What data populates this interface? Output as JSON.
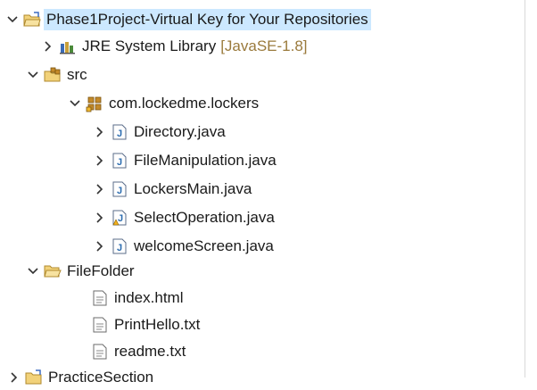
{
  "tree": {
    "project": {
      "label": "Phase1Project-Virtual Key for Your Repositories"
    },
    "jre": {
      "label": "JRE System Library",
      "decoration": "[JavaSE-1.8]"
    },
    "src": {
      "label": "src"
    },
    "package": {
      "label": "com.lockedme.lockers"
    },
    "files": [
      {
        "label": "Directory.java",
        "icon": "java-file-icon"
      },
      {
        "label": "FileManipulation.java",
        "icon": "java-file-icon"
      },
      {
        "label": "LockersMain.java",
        "icon": "java-file-icon"
      },
      {
        "label": "SelectOperation.java",
        "icon": "java-file-warning-icon"
      },
      {
        "label": "welcomeScreen.java",
        "icon": "java-file-icon"
      }
    ],
    "folder": {
      "label": "FileFolder"
    },
    "folder_files": [
      {
        "label": "index.html",
        "icon": "html-file-icon"
      },
      {
        "label": "PrintHello.txt",
        "icon": "text-file-icon"
      },
      {
        "label": "readme.txt",
        "icon": "text-file-icon"
      }
    ],
    "next_project": {
      "label": "PracticeSection"
    }
  },
  "colors": {
    "selection": "#cce8ff",
    "decoration": "#9a7a3c",
    "folder": "#e8b84a",
    "java": "#2b6cb0"
  }
}
